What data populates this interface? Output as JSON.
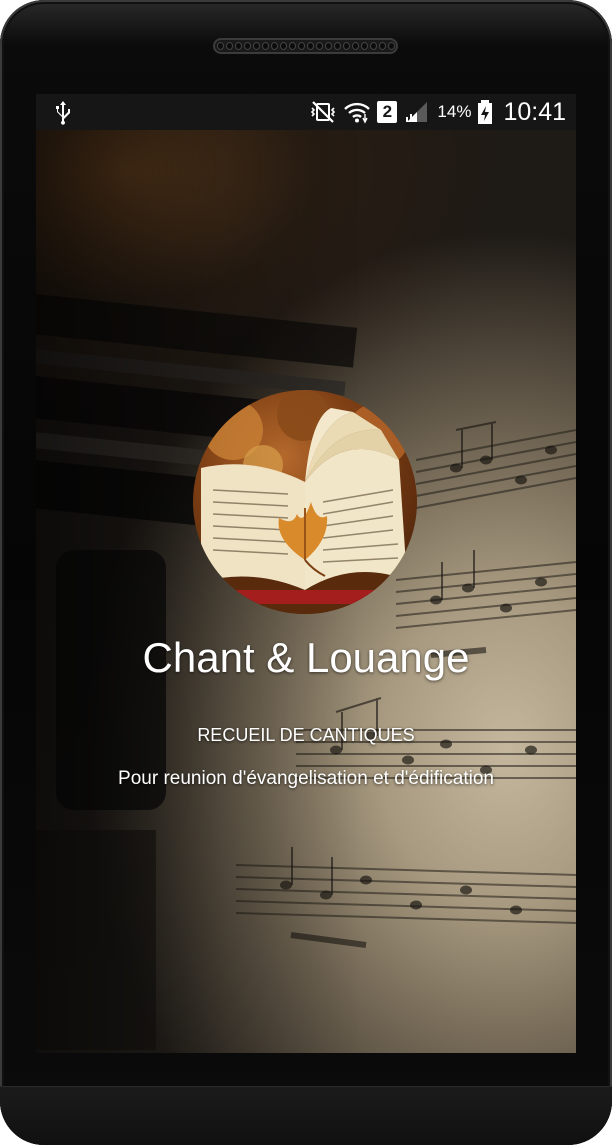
{
  "status_bar": {
    "icons": [
      "usb-icon",
      "vibrate-off-icon",
      "wifi-icon",
      "sim-2-icon",
      "signal-icon",
      "battery-charging-icon"
    ],
    "sim_label": "2",
    "battery_percent": "14%",
    "time": "10:41"
  },
  "splash": {
    "title": "Chant & Louange",
    "subtitle": "RECUEIL DE CANTIQUES",
    "tagline": "Pour reunion d'évangelisation et d'édification",
    "logo_icon": "open-book-leaf-icon"
  },
  "colors": {
    "bezel": "#050505",
    "status_bar": "#161616",
    "text": "#ffffff",
    "leaf": "#d98a2b"
  }
}
